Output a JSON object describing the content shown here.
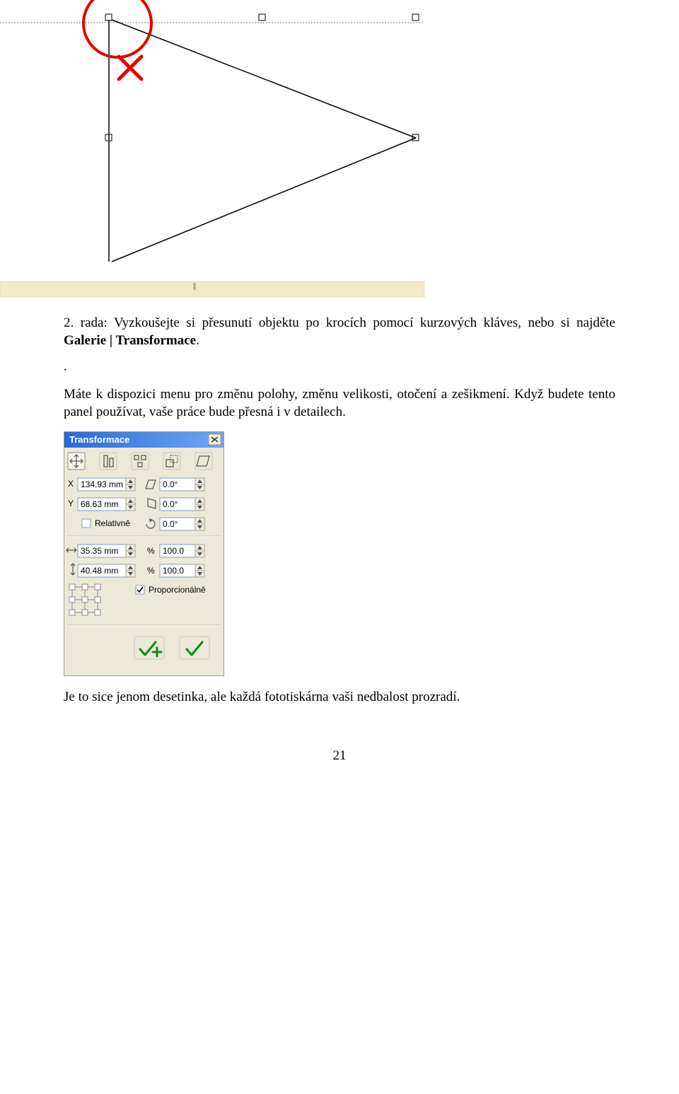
{
  "diagram": {
    "annotation_circle": true
  },
  "tip2_prefix": "2. rada:",
  "tip2_body": " Vyzkoušejte si přesunutí objektu po krocích pomocí kurzových kláves, nebo si najděte ",
  "tip2_menu": "Galerie | Transformace",
  "tip2_suffix": ".",
  "standalone_dot": ".",
  "para2": "Máte k dispozici menu pro změnu polohy, změnu velikosti, otočení a zešikmení. Když budete tento panel používat, vaše práce bude přesná i v detailech.",
  "panel": {
    "title": "Transformace",
    "x_label": "X",
    "x_value": "134.93 mm",
    "y_label": "Y",
    "y_value": "68.63 mm",
    "rel_label": "Relativně",
    "rel_checked": false,
    "w_value": "35.35 mm",
    "h_value": "40.48 mm",
    "skew_h_value": "0.0°",
    "skew_v_value": "0.0°",
    "rotate_value": "0.0°",
    "scale_x_value": "100.0",
    "scale_y_value": "100.0",
    "percent_label": "%",
    "prop_label": "Proporcionálně",
    "prop_checked": true
  },
  "para3": "Je to sice jenom desetinka, ale každá fototiskárna vaši nedbalost prozradí.",
  "page_number": "21"
}
